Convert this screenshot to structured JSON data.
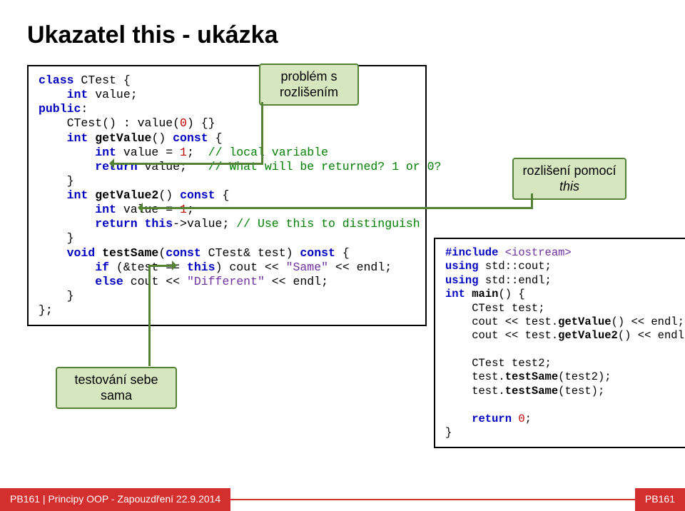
{
  "title": "Ukazatel this - ukázka",
  "callouts": {
    "c1": "problém s\nrozlišením",
    "c2_before": "rozlišení pomocí ",
    "c2_italic": "this",
    "c3": "testování sebe sama"
  },
  "code_left": {
    "l1a": "class ",
    "l1b": "CTest {",
    "l2a": "    int ",
    "l2b": "value;",
    "l3a": "public",
    "l3b": ":",
    "l4a": "    CTest() : value(",
    "l4b": "0",
    "l4c": ") {}",
    "l5a": "    int ",
    "l5b": "getValue",
    "l5c": "() ",
    "l5d": "const ",
    "l5e": "{",
    "l6a": "        int ",
    "l6b": "value = ",
    "l6c": "1",
    "l6d": ";  ",
    "l6e": "// local variable",
    "l7a": "        return ",
    "l7b": "value;   ",
    "l7c": "// What will be returned? 1 or 0?",
    "l8": "    }",
    "l9a": "    int ",
    "l9b": "getValue2",
    "l9c": "() ",
    "l9d": "const ",
    "l9e": "{",
    "l10a": "        int ",
    "l10b": "value = ",
    "l10c": "1",
    "l10d": ";",
    "l11a": "        return ",
    "l11b": "this",
    "l11c": "->value; ",
    "l11d": "// Use this to distinguish",
    "l12": "    }",
    "l13a": "    void ",
    "l13b": "testSame",
    "l13c": "(",
    "l13d": "const ",
    "l13e": "CTest& test) ",
    "l13f": "const ",
    "l13g": "{",
    "l14a": "        if ",
    "l14b": "(&test == ",
    "l14c": "this",
    "l14d": ") cout << ",
    "l14e": "\"Same\"",
    "l14f": " << endl;",
    "l15a": "        else ",
    "l15b": "cout << ",
    "l15c": "\"Different\"",
    "l15d": " << endl;",
    "l16": "    }",
    "l17": "};"
  },
  "code_right": {
    "l1a": "#include ",
    "l1b": "<iostream>",
    "l2a": "using ",
    "l2b": "std::cout;",
    "l3a": "using ",
    "l3b": "std::endl;",
    "l4a": "int ",
    "l4b": "main",
    "l4c": "() {",
    "l5": "    CTest test;",
    "l6a": "    cout << test.",
    "l6b": "getValue",
    "l6c": "() << endl;",
    "l7a": "    cout << test.",
    "l7b": "getValue2",
    "l7c": "() << endl;",
    "blank": " ",
    "l8": "    CTest test2;",
    "l9a": "    test.",
    "l9b": "testSame",
    "l9c": "(test2);",
    "l10a": "    test.",
    "l10b": "testSame",
    "l10c": "(test);",
    "blank2": " ",
    "l11a": "    return ",
    "l11b": "0",
    "l11c": ";",
    "l12": "}"
  },
  "footer": {
    "left": "PB161 | Principy OOP - Zapouzdření 22.9.2014",
    "right": "PB161"
  }
}
